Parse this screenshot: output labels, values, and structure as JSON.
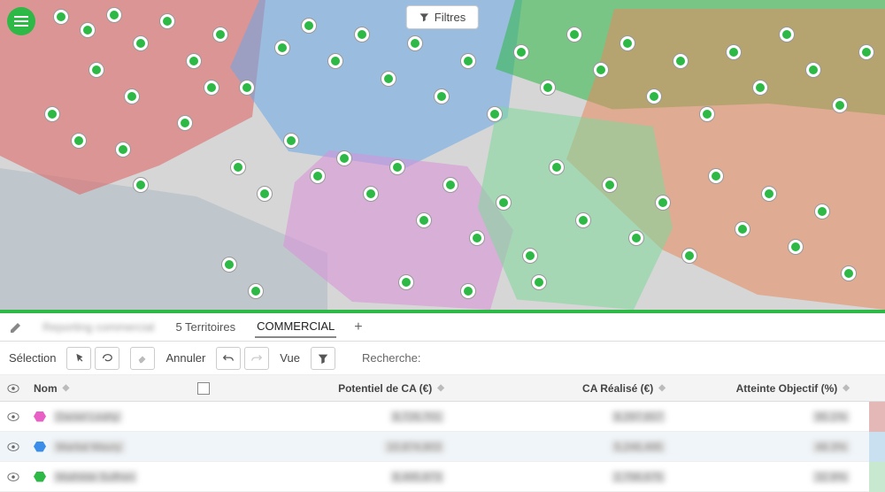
{
  "filters_label": "Filtres",
  "tabs": {
    "blurred": "Reporting commercial",
    "territoires": "5 Territoires",
    "commercial": "COMMERCIAL"
  },
  "toolbar": {
    "selection": "Sélection",
    "annuler": "Annuler",
    "vue": "Vue",
    "recherche": "Recherche:"
  },
  "columns": {
    "nom": "Nom",
    "potentiel": "Potentiel de CA (€)",
    "ca_realise": "CA Réalisé (€)",
    "atteinte": "Atteinte Objectif (%)"
  },
  "rows": [
    {
      "hex_color": "#e85fc5",
      "name": "Daniel Leahy",
      "pot": "8,726,701",
      "ca": "8,297,657",
      "obj": "95.1%",
      "alt": false,
      "ec": "ec1"
    },
    {
      "hex_color": "#3a8de8",
      "name": "Martial Maury",
      "pot": "10,874,803",
      "ca": "5,246,495",
      "obj": "48.3%",
      "alt": true,
      "ec": "ec2"
    },
    {
      "hex_color": "#2eb846",
      "name": "Mathilde Suffren",
      "pot": "8,495,873",
      "ca": "2,798,675",
      "obj": "32.9%",
      "alt": false,
      "ec": "ec3"
    }
  ]
}
